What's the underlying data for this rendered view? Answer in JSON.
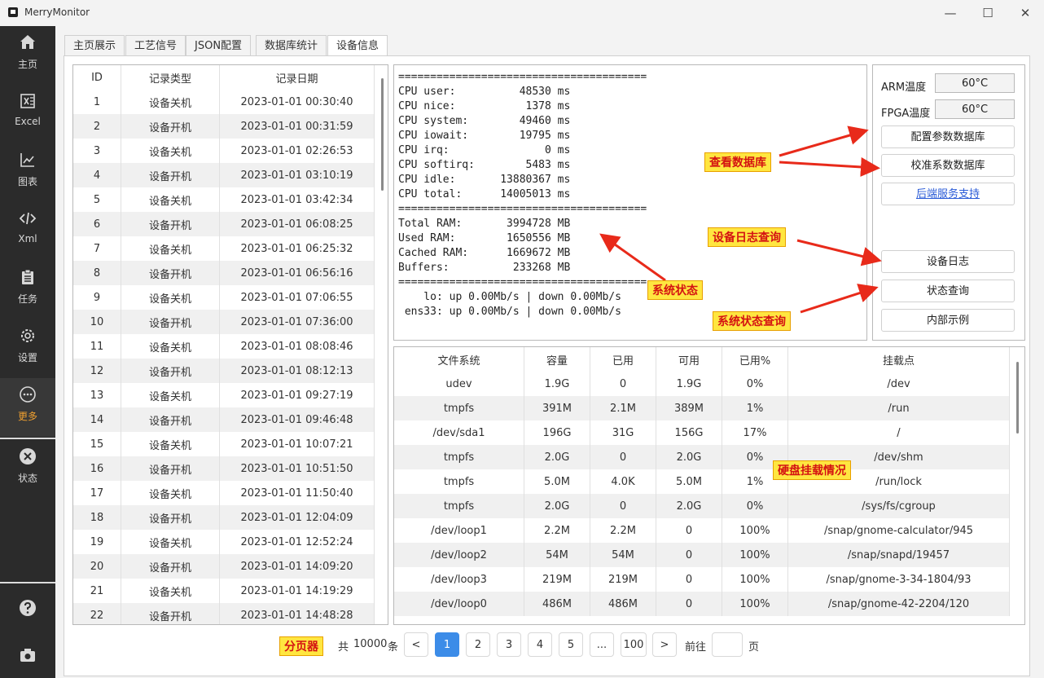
{
  "window": {
    "title": "MerryMonitor",
    "minimize": "—",
    "maximize": "☐",
    "close": "✕"
  },
  "sidebar": {
    "items": [
      {
        "label": "主页",
        "icon": "home-icon"
      },
      {
        "label": "Excel",
        "icon": "excel-icon"
      },
      {
        "label": "图表",
        "icon": "chart-icon"
      },
      {
        "label": "Xml",
        "icon": "code-icon"
      },
      {
        "label": "任务",
        "icon": "clipboard-icon"
      },
      {
        "label": "设置",
        "icon": "gear-icon"
      },
      {
        "label": "更多",
        "icon": "more-icon"
      },
      {
        "label": "状态",
        "icon": "status-icon"
      }
    ],
    "active_color": "#f0a030"
  },
  "tabs": [
    "主页展示",
    "工艺信号",
    "JSON配置",
    "数据库统计",
    "设备信息"
  ],
  "log_table": {
    "headers": [
      "ID",
      "记录类型",
      "记录日期"
    ],
    "rows": [
      [
        "1",
        "设备关机",
        "2023-01-01 00:30:40"
      ],
      [
        "2",
        "设备开机",
        "2023-01-01 00:31:59"
      ],
      [
        "3",
        "设备关机",
        "2023-01-01 02:26:53"
      ],
      [
        "4",
        "设备开机",
        "2023-01-01 03:10:19"
      ],
      [
        "5",
        "设备关机",
        "2023-01-01 03:42:34"
      ],
      [
        "6",
        "设备开机",
        "2023-01-01 06:08:25"
      ],
      [
        "7",
        "设备关机",
        "2023-01-01 06:25:32"
      ],
      [
        "8",
        "设备开机",
        "2023-01-01 06:56:16"
      ],
      [
        "9",
        "设备关机",
        "2023-01-01 07:06:55"
      ],
      [
        "10",
        "设备开机",
        "2023-01-01 07:36:00"
      ],
      [
        "11",
        "设备关机",
        "2023-01-01 08:08:46"
      ],
      [
        "12",
        "设备开机",
        "2023-01-01 08:12:13"
      ],
      [
        "13",
        "设备关机",
        "2023-01-01 09:27:19"
      ],
      [
        "14",
        "设备开机",
        "2023-01-01 09:46:48"
      ],
      [
        "15",
        "设备关机",
        "2023-01-01 10:07:21"
      ],
      [
        "16",
        "设备开机",
        "2023-01-01 10:51:50"
      ],
      [
        "17",
        "设备关机",
        "2023-01-01 11:50:40"
      ],
      [
        "18",
        "设备开机",
        "2023-01-01 12:04:09"
      ],
      [
        "19",
        "设备关机",
        "2023-01-01 12:52:24"
      ],
      [
        "20",
        "设备开机",
        "2023-01-01 14:09:20"
      ],
      [
        "21",
        "设备关机",
        "2023-01-01 14:19:29"
      ],
      [
        "22",
        "设备开机",
        "2023-01-01 14:48:28"
      ]
    ]
  },
  "sysinfo": {
    "text": "=======================================\nCPU user:          48530 ms\nCPU nice:           1378 ms\nCPU system:        49460 ms\nCPU iowait:        19795 ms\nCPU irq:               0 ms\nCPU softirq:        5483 ms\nCPU idle:       13880367 ms\nCPU total:      14005013 ms\n=======================================\nTotal RAM:       3994728 MB\nUsed RAM:        1650556 MB\nCached RAM:      1669672 MB\nBuffers:          233268 MB\n=======================================\n    lo: up 0.00Mb/s | down 0.00Mb/s\n ens33: up 0.00Mb/s | down 0.00Mb/s"
  },
  "right_panel": {
    "arm_label": "ARM温度",
    "arm_value": "60°C",
    "fpga_label": "FPGA温度",
    "fpga_value": "60°C",
    "btn_config_db": "配置参数数据库",
    "btn_calib_db": "校准系数数据库",
    "link_backend": "后端服务支持",
    "btn_device_log": "设备日志",
    "btn_status_query": "状态查询",
    "btn_internal_example": "内部示例"
  },
  "fs_table": {
    "headers": [
      "文件系统",
      "容量",
      "已用",
      "可用",
      "已用%",
      "挂载点"
    ],
    "rows": [
      [
        "udev",
        "1.9G",
        "0",
        "1.9G",
        "0%",
        "/dev"
      ],
      [
        "tmpfs",
        "391M",
        "2.1M",
        "389M",
        "1%",
        "/run"
      ],
      [
        "/dev/sda1",
        "196G",
        "31G",
        "156G",
        "17%",
        "/"
      ],
      [
        "tmpfs",
        "2.0G",
        "0",
        "2.0G",
        "0%",
        "/dev/shm"
      ],
      [
        "tmpfs",
        "5.0M",
        "4.0K",
        "5.0M",
        "1%",
        "/run/lock"
      ],
      [
        "tmpfs",
        "2.0G",
        "0",
        "2.0G",
        "0%",
        "/sys/fs/cgroup"
      ],
      [
        "/dev/loop1",
        "2.2M",
        "2.2M",
        "0",
        "100%",
        "/snap/gnome-calculator/945"
      ],
      [
        "/dev/loop2",
        "54M",
        "54M",
        "0",
        "100%",
        "/snap/snapd/19457"
      ],
      [
        "/dev/loop3",
        "219M",
        "219M",
        "0",
        "100%",
        "/snap/gnome-3-34-1804/93"
      ],
      [
        "/dev/loop0",
        "486M",
        "486M",
        "0",
        "100%",
        "/snap/gnome-42-2204/120"
      ]
    ]
  },
  "annotations": {
    "view_db": "查看数据库",
    "device_log_query": "设备日志查询",
    "system_status": "系统状态",
    "system_status_query": "系统状态查询",
    "disk_mount": "硬盘挂载情况",
    "pager": "分页器",
    "color": "#e82a1a"
  },
  "pager": {
    "total_prefix": "共",
    "total": "10000",
    "total_suffix": "条",
    "prev": "<",
    "pages": [
      "1",
      "2",
      "3",
      "4",
      "5",
      "...",
      "100"
    ],
    "next": ">",
    "goto_prefix": "前往",
    "goto_value": "",
    "goto_suffix": "页",
    "active_color": "#3c8ce8"
  }
}
